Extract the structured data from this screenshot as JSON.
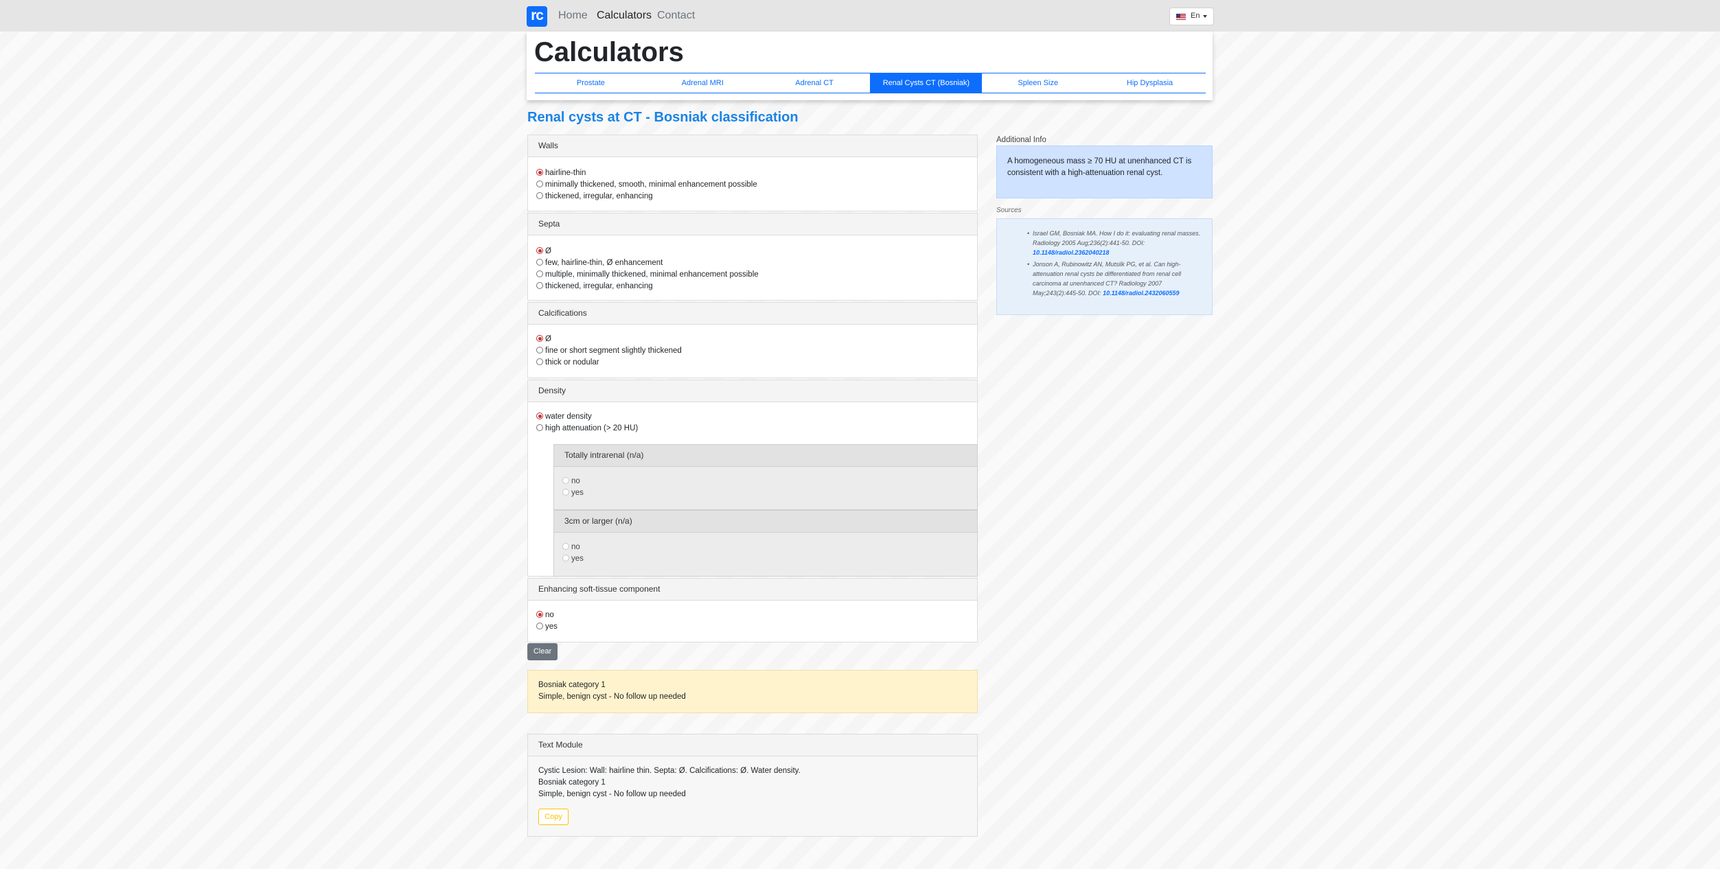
{
  "nav": {
    "logo_text": "rc",
    "links": [
      "Home",
      "Calculators",
      "Contact"
    ],
    "active_link": "Calculators",
    "language": "En"
  },
  "header": {
    "title": "Calculators",
    "tabs": [
      "Prostate",
      "Adrenal MRI",
      "Adrenal CT",
      "Renal Cysts CT (Bosniak)",
      "Spleen Size",
      "Hip Dysplasia"
    ],
    "active_tab": "Renal Cysts CT (Bosniak)"
  },
  "page_title": "Renal cysts at CT - Bosniak classification",
  "sections": {
    "walls": {
      "label": "Walls",
      "options": [
        "hairline-thin",
        "minimally thickened, smooth, minimal enhancement possible",
        "thickened, irregular, enhancing"
      ],
      "selected": 0
    },
    "septa": {
      "label": "Septa",
      "options": [
        "Ø",
        "few, hairline-thin, Ø enhancement",
        "multiple, minimally thickened, minimal enhancement possible",
        "thickened, irregular, enhancing"
      ],
      "selected": 0
    },
    "calcifications": {
      "label": "Calcifications",
      "options": [
        "Ø",
        "fine or short segment slightly thickened",
        "thick or nodular"
      ],
      "selected": 0
    },
    "density": {
      "label": "Density",
      "options": [
        "water density",
        "high attenuation (> 20 HU)"
      ],
      "selected": 0,
      "sub_intrarenal": {
        "label": "Totally intrarenal (n/a)",
        "options": [
          "no",
          "yes"
        ]
      },
      "sub_size": {
        "label": "3cm or larger (n/a)",
        "options": [
          "no",
          "yes"
        ]
      }
    },
    "enhancing": {
      "label": "Enhancing soft-tissue component",
      "options": [
        "no",
        "yes"
      ],
      "selected": 0
    }
  },
  "clear_label": "Clear",
  "result": {
    "category": "Bosniak category 1",
    "recommendation": "Simple, benign cyst - No follow up needed"
  },
  "text_module": {
    "label": "Text Module",
    "lines": [
      "Cystic Lesion: Wall: hairline thin. Septa: Ø. Calcifications: Ø. Water density.",
      "Bosniak category 1",
      "Simple, benign cyst - No follow up needed"
    ],
    "copy_label": "Copy"
  },
  "additional_info": {
    "label": "Additional Info",
    "text": "A homogeneous mass ≥ 70 HU at unenhanced CT is consistent with a high-attenuation renal cyst."
  },
  "sources": {
    "label": "Sources",
    "items": [
      {
        "text": "Israel GM, Bosniak MA. How I do it: evaluating renal masses. Radiology 2005 Aug;236(2):441-50. DOI:",
        "doi": "10.1148/radiol.2362040218"
      },
      {
        "text": "Jonson A, Rubinowitz AN, Mutsilk PG, et al. Can high-attenuation renal cysts be differentiated from renal cell carcinoma at unenhanced CT? Radiology 2007 May;243(2):445-50. DOI:",
        "doi": "10.1148/radiol.2432060559"
      }
    ]
  },
  "colors": {
    "primary": "#0d6efd",
    "title_blue": "#1a83e6",
    "result_bg": "#fff3cd",
    "info_bg": "#cfe2ff",
    "radio_checked": "#c43030"
  }
}
